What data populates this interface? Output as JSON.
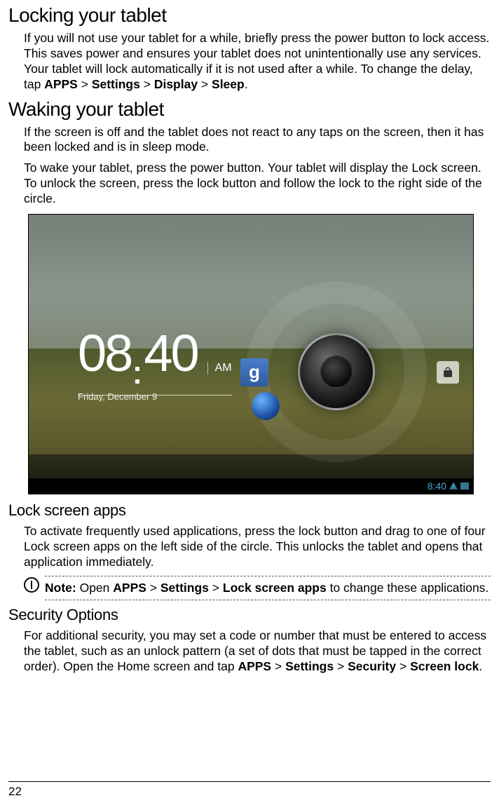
{
  "sections": {
    "locking": {
      "title": "Locking your tablet",
      "p1_pre": "If you will not use your tablet for a while, briefly press the power button to lock access. This saves power and ensures your tablet does not unintentionally use any services. Your tablet will lock automatically if it is not used after a while. To change the delay, tap ",
      "bc1": "APPS",
      "sep": " > ",
      "bc2": "Settings",
      "bc3": "Display",
      "bc4": "Sleep",
      "p1_post": "."
    },
    "waking": {
      "title": "Waking your tablet",
      "p1": "If the screen is off and the tablet does not react to any taps on the screen, then it has been locked and is in sleep mode.",
      "p2": "To wake your tablet, press the power button. Your tablet will display the Lock screen. To unlock the screen, press the lock button and follow the lock to the right side of the circle."
    },
    "lockapps": {
      "title": "Lock screen apps",
      "p1": "To activate frequently used applications, press the lock button and drag to one of four Lock screen apps on the left side of the circle. This unlocks the tablet and opens that application immediately.",
      "note_pre": "Note: ",
      "note_mid1": "Open ",
      "note_bc1": "APPS",
      "note_bc2": "Settings",
      "note_bc3": "Lock screen apps",
      "note_tail": " to change these applications."
    },
    "security": {
      "title": "Security Options",
      "p1_pre": "For additional security, you may set a code or number that must be entered to access the tablet, such as an unlock pattern (a set of dots that must be tapped in the correct order). Open the Home screen and tap ",
      "bc1": "APPS",
      "bc2": "Settings",
      "bc3": "Security",
      "bc4": "Screen lock",
      "p1_post": "."
    }
  },
  "lockscreen": {
    "hours": "08",
    "minutes": "40",
    "ampm": "AM",
    "date": "Friday, December 9",
    "google_g": "g",
    "status_time": "8:40"
  },
  "page_number": "22"
}
